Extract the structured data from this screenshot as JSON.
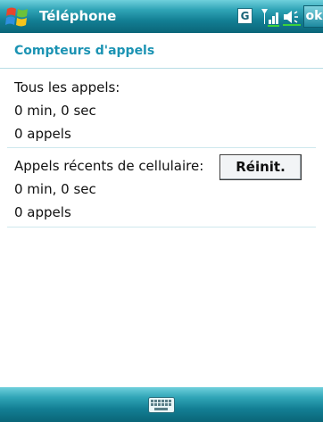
{
  "titlebar": {
    "app_title": "Téléphone",
    "g_indicator": "G",
    "ok_label": "ok",
    "icons": [
      "windows-start-icon",
      "network-g-icon",
      "signal-strength-icon",
      "volume-icon"
    ]
  },
  "section": {
    "title": "Compteurs d'appels"
  },
  "all_calls": {
    "label": "Tous les appels:",
    "duration": "0 min, 0 sec",
    "count": "0 appels"
  },
  "recent_calls": {
    "label": "Appels récents de cellulaire:",
    "duration": "0 min, 0 sec",
    "count": "0 appels",
    "reset_label": "Réinit."
  },
  "bottombar": {
    "icons": [
      "keyboard-icon"
    ]
  },
  "colors": {
    "bar_light": "#6fd0dc",
    "bar_dark": "#0a6578",
    "section_title": "#1b93b3",
    "divider": "#cfe8ee"
  }
}
